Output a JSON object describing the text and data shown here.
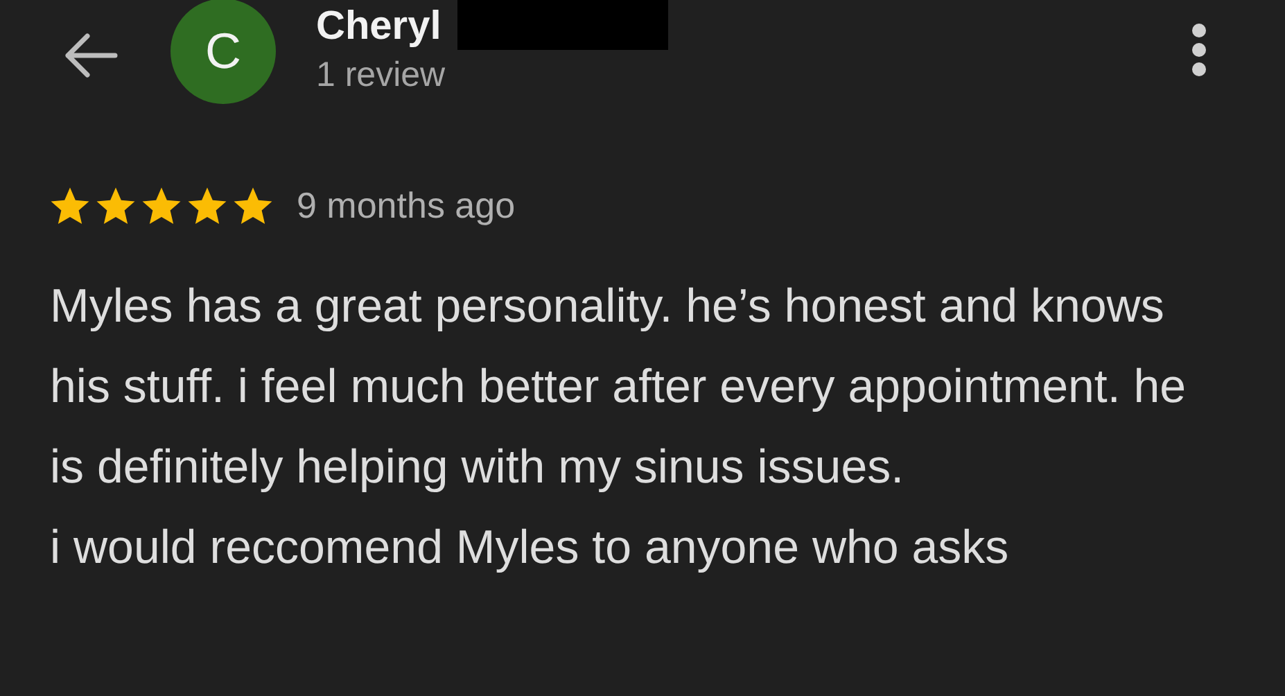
{
  "reviewer": {
    "avatar_letter": "C",
    "name": "Cheryl",
    "name_redacted": true,
    "review_count": "1 review"
  },
  "review": {
    "stars": 5,
    "time": "9 months ago",
    "paragraphs": [
      "Myles has a great personality. he’s honest and knows his stuff. i feel much better after every appointment. he is definitely helping with my sinus issues.",
      "i would reccomend Myles to anyone who asks"
    ]
  }
}
